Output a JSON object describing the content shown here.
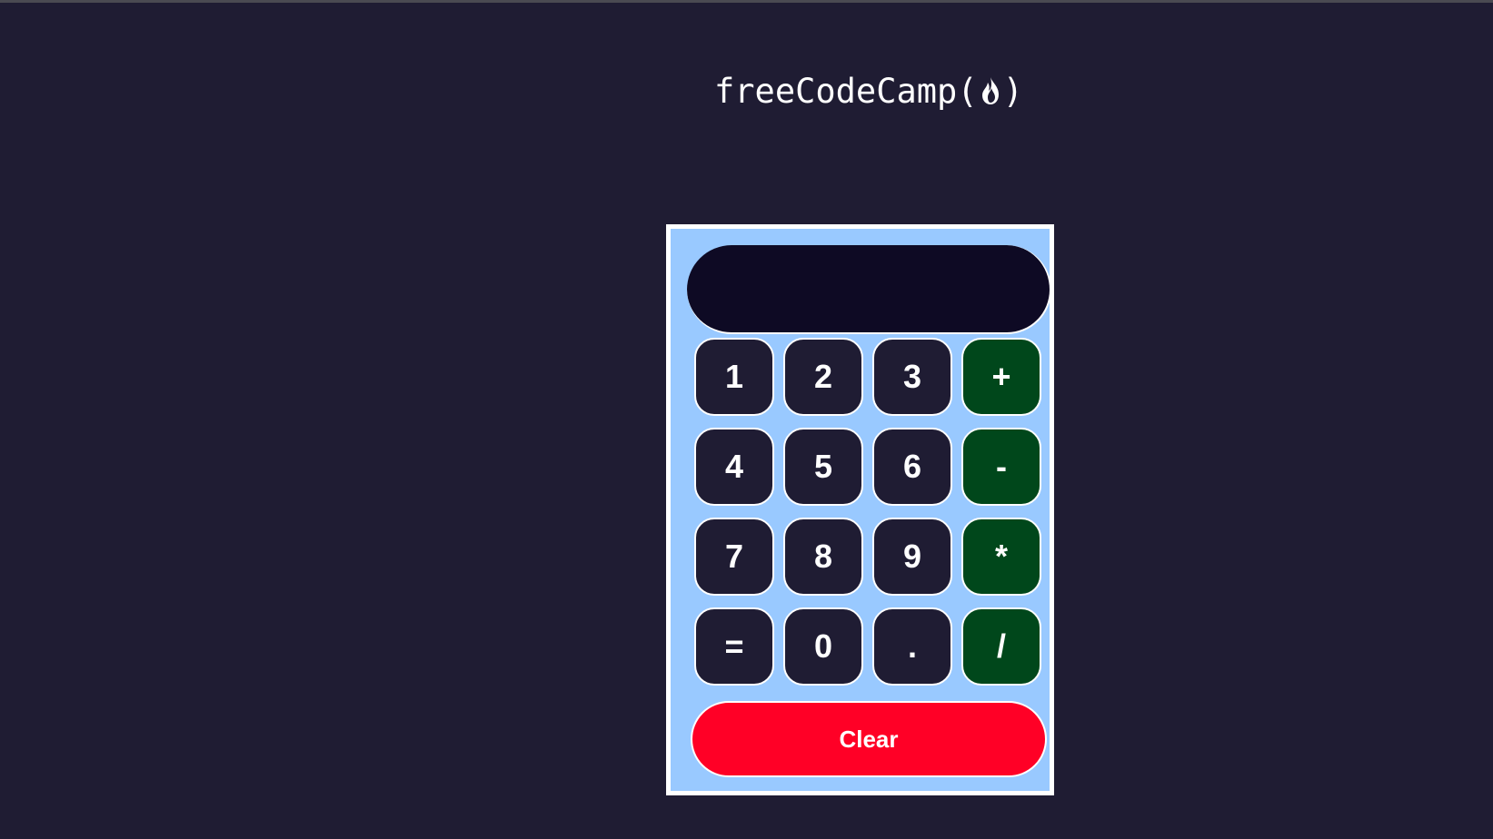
{
  "brand": {
    "text": "freeCodeCamp",
    "open_paren": "(",
    "close_paren": ")",
    "icon": "flame-icon"
  },
  "display": {
    "value": ""
  },
  "keys": [
    {
      "label": "1",
      "type": "digit"
    },
    {
      "label": "2",
      "type": "digit"
    },
    {
      "label": "3",
      "type": "digit"
    },
    {
      "label": "+",
      "type": "operator"
    },
    {
      "label": "4",
      "type": "digit"
    },
    {
      "label": "5",
      "type": "digit"
    },
    {
      "label": "6",
      "type": "digit"
    },
    {
      "label": "-",
      "type": "operator"
    },
    {
      "label": "7",
      "type": "digit"
    },
    {
      "label": "8",
      "type": "digit"
    },
    {
      "label": "9",
      "type": "digit"
    },
    {
      "label": "*",
      "type": "operator"
    },
    {
      "label": "=",
      "type": "digit"
    },
    {
      "label": "0",
      "type": "digit"
    },
    {
      "label": ".",
      "type": "digit"
    },
    {
      "label": "/",
      "type": "operator"
    }
  ],
  "clear": {
    "label": "Clear"
  },
  "colors": {
    "page_background": "#1f1c33",
    "calculator_body": "#99c9ff",
    "display_background": "#0e0a24",
    "key_background": "#1f1c33",
    "operator_background": "#00471b",
    "clear_background": "#ff0026"
  }
}
